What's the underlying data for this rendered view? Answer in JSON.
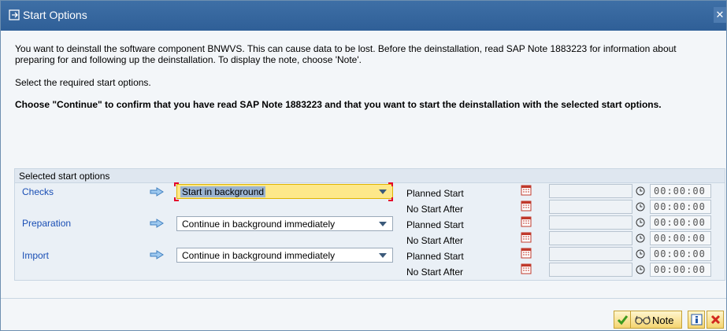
{
  "window": {
    "title": "Start Options",
    "close_glyph": "✕"
  },
  "messages": {
    "line1": "You want to deinstall the software component BNWVS. This can cause data to be lost. Before the deinstallation, read SAP Note 1883223 for information about",
    "line2": "preparing for and following up the deinstallation. To display the note, choose 'Note'.",
    "line3": "Select the required start options.",
    "line4": "Choose \"Continue\" to confirm that you have read SAP Note 1883223 and that you want to start the deinstallation with the selected start options."
  },
  "group": {
    "title": "Selected start options",
    "rows": [
      {
        "label": "Checks",
        "option": "Start in background"
      },
      {
        "label": "Preparation",
        "option": "Continue in background immediately"
      },
      {
        "label": "Import",
        "option": "Continue in background immediately"
      }
    ],
    "schedule": [
      {
        "label": "Planned Start",
        "time": "00:00:00"
      },
      {
        "label": "No Start After",
        "time": "00:00:00"
      },
      {
        "label": "Planned Start",
        "time": "00:00:00"
      },
      {
        "label": "No Start After",
        "time": "00:00:00"
      },
      {
        "label": "Planned Start",
        "time": "00:00:00"
      },
      {
        "label": "No Start After",
        "time": "00:00:00"
      }
    ]
  },
  "footer": {
    "note_label": "Note"
  },
  "colors": {
    "title_bar": "#2f5f97",
    "link_blue": "#1a4fb5",
    "active_field": "#fde88a"
  }
}
